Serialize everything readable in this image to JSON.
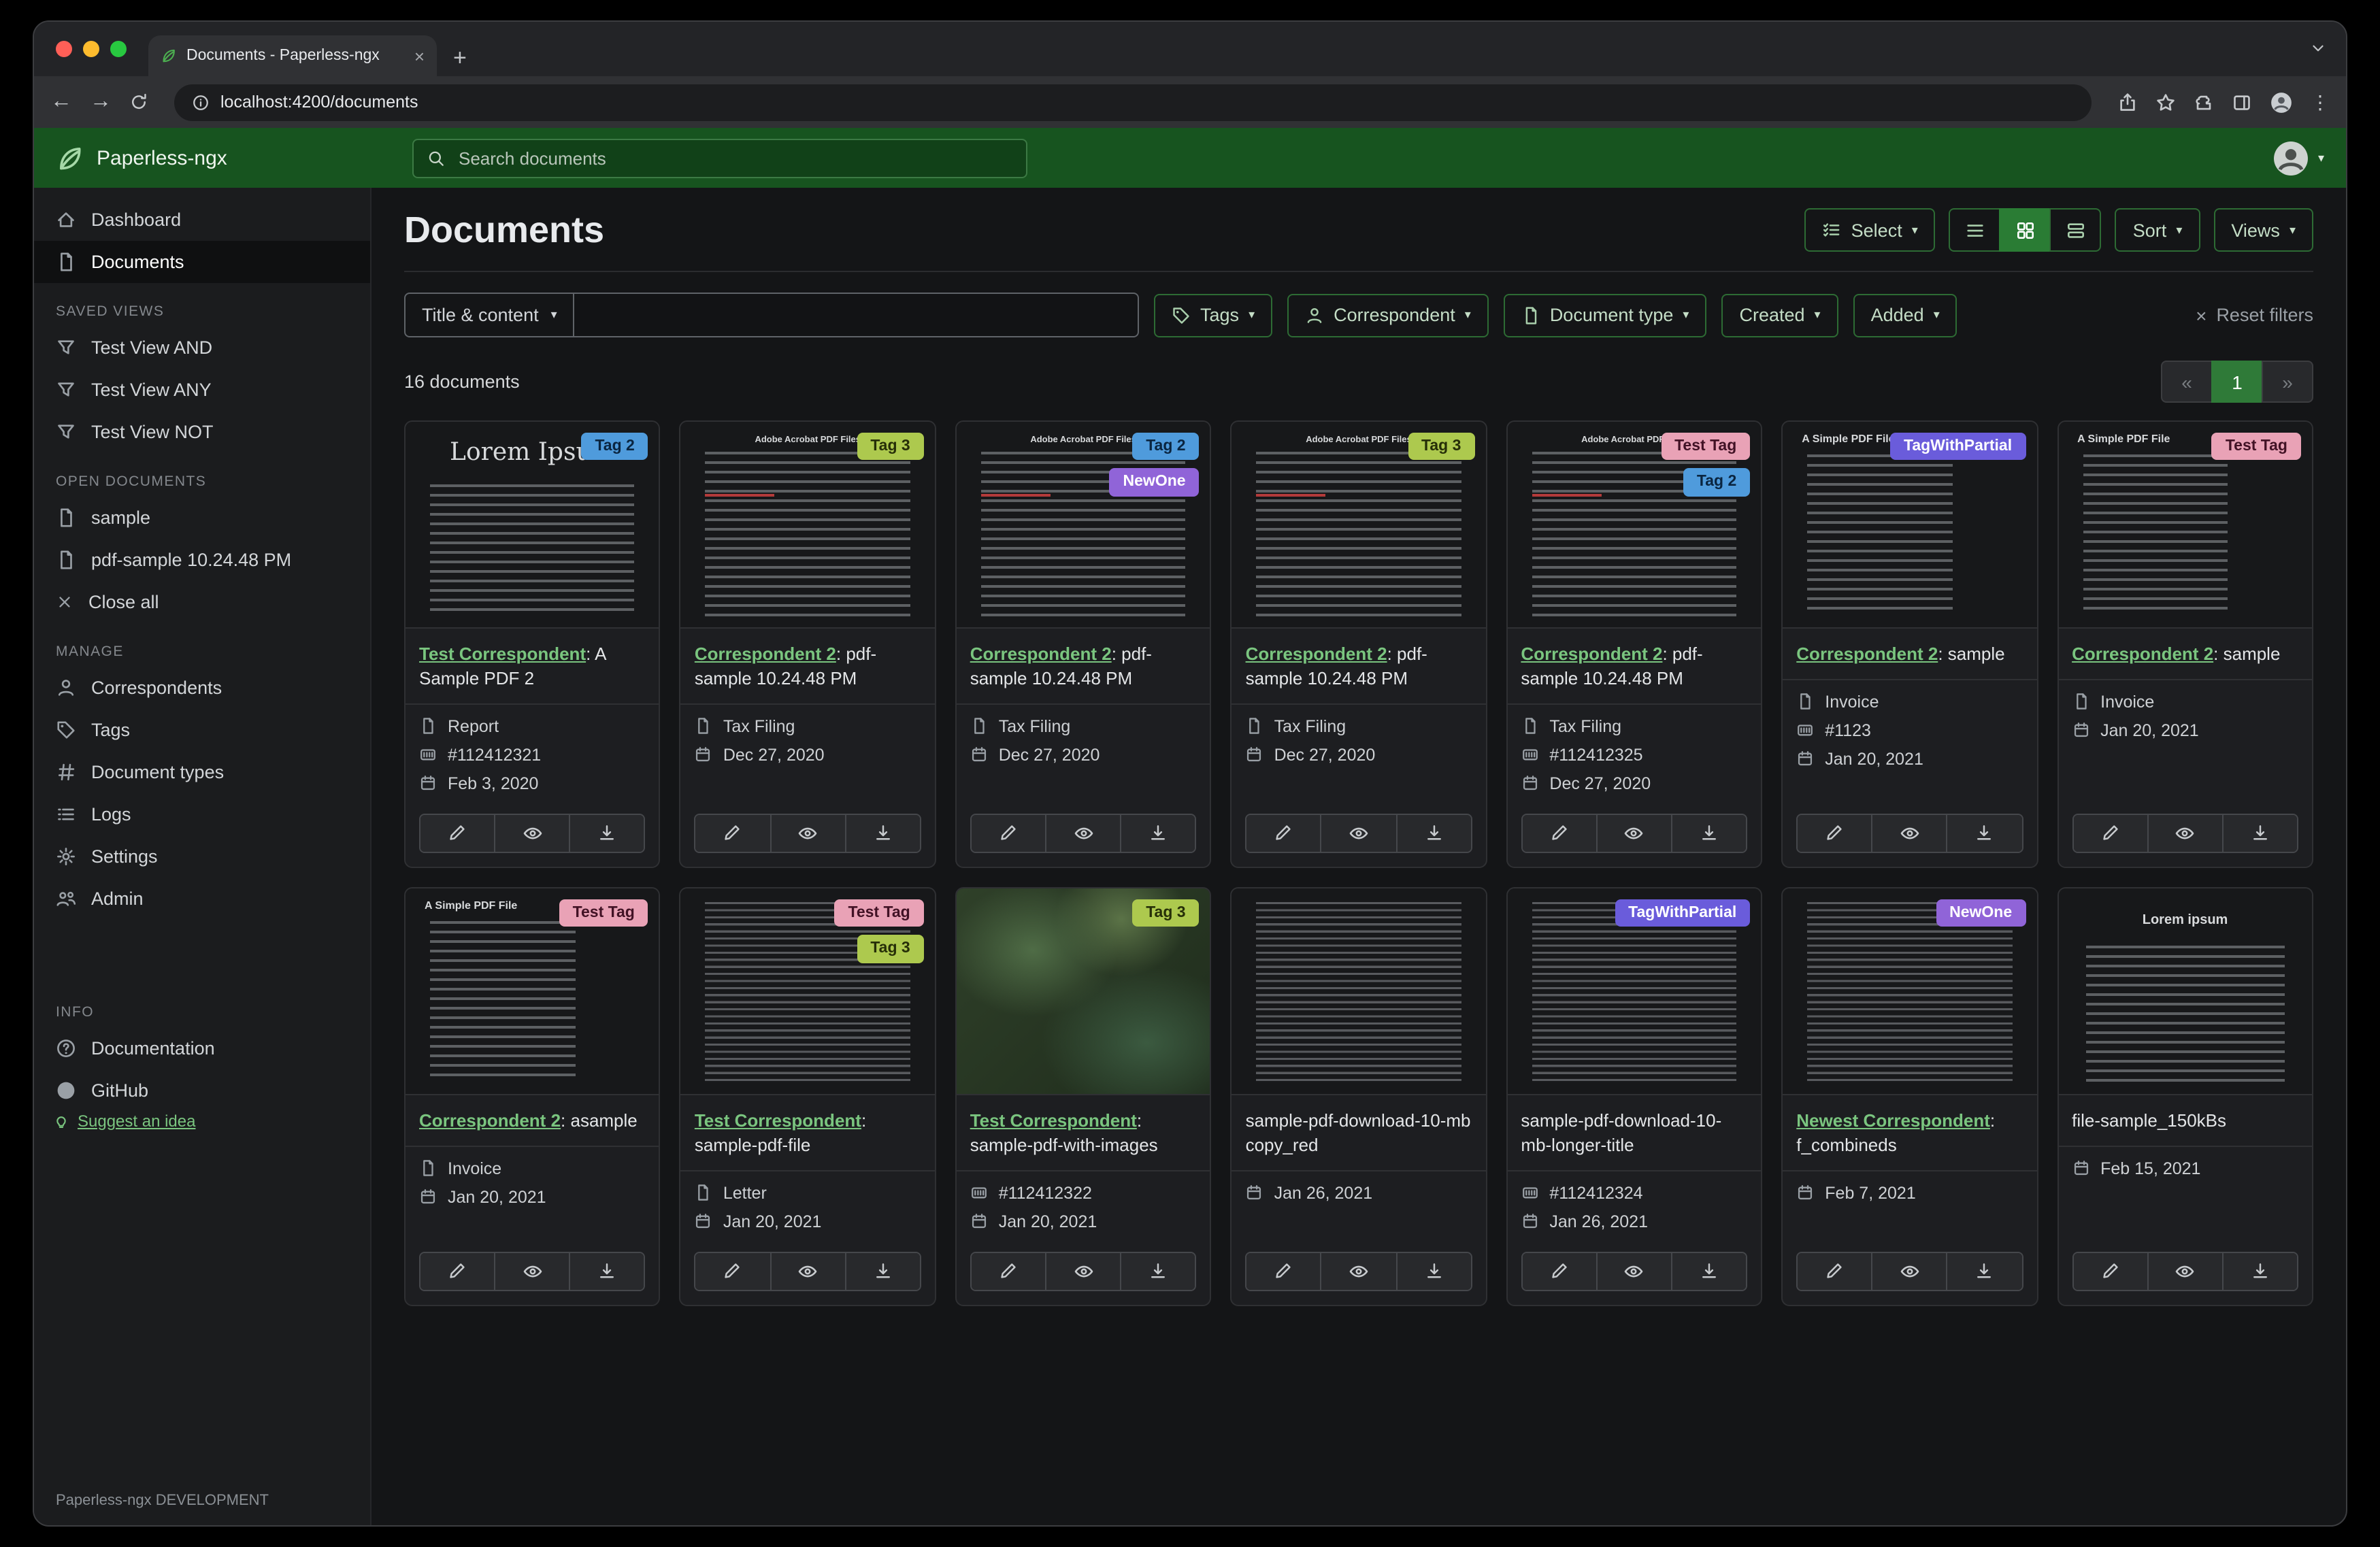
{
  "colors": {
    "accent_green": "#17541f",
    "link_green": "#7ac57f",
    "tag_colors": {
      "Tag 2": {
        "bg": "#4f9bdc",
        "fg": "#0a2540"
      },
      "Tag 3": {
        "bg": "#adc94e",
        "fg": "#262f08"
      },
      "NewOne": {
        "bg": "#9064d8",
        "fg": "#ffffff"
      },
      "Test Tag": {
        "bg": "#e9a2b6",
        "fg": "#421225"
      },
      "TagWithPartial": {
        "bg": "#6a5cdb",
        "fg": "#ffffff"
      }
    }
  },
  "browser": {
    "tab_title": "Documents - Paperless-ngx",
    "new_tab": "+",
    "url": "localhost:4200/documents"
  },
  "header": {
    "app_name": "Paperless-ngx",
    "search_placeholder": "Search documents"
  },
  "sidebar": {
    "nav": [
      {
        "label": "Dashboard"
      },
      {
        "label": "Documents"
      }
    ],
    "saved_views_header": "SAVED VIEWS",
    "saved_views": [
      "Test View AND",
      "Test View ANY",
      "Test View NOT"
    ],
    "open_documents_header": "OPEN DOCUMENTS",
    "open_documents": [
      "sample",
      "pdf-sample 10.24.48 PM"
    ],
    "close_all": "Close all",
    "manage_header": "MANAGE",
    "manage": [
      "Correspondents",
      "Tags",
      "Document types",
      "Logs",
      "Settings",
      "Admin"
    ],
    "info_header": "INFO",
    "documentation": "Documentation",
    "github": "GitHub",
    "suggest": "Suggest an idea",
    "footer": "Paperless-ngx DEVELOPMENT"
  },
  "main": {
    "title": "Documents",
    "select_label": "Select",
    "sort_label": "Sort",
    "views_label": "Views",
    "filter_title_content": "Title & content",
    "filter_buttons": [
      "Tags",
      "Correspondent",
      "Document type",
      "Created",
      "Added"
    ],
    "reset_label": "Reset filters",
    "count_text": "16 documents",
    "pagination": {
      "prev": "«",
      "page": "1",
      "next": "»"
    }
  },
  "cards": [
    {
      "tags": [
        "Tag 2"
      ],
      "thumb": "lorem",
      "thumb_title": "Lorem Ipsum",
      "correspondent": "Test Correspondent",
      "title_rest": ": A Sample PDF 2",
      "doc_type": "Report",
      "asn": "#112412321",
      "date": "Feb 3, 2020"
    },
    {
      "tags": [
        "Tag 3"
      ],
      "thumb": "pdfguide",
      "thumb_title": "Adobe Acrobat PDF Files",
      "correspondent": "Correspondent 2",
      "title_rest": ": pdf-sample 10.24.48 PM",
      "doc_type": "Tax Filing",
      "date": "Dec 27, 2020"
    },
    {
      "tags": [
        "Tag 2",
        "NewOne"
      ],
      "thumb": "pdfguide",
      "thumb_title": "Adobe Acrobat PDF Files",
      "correspondent": "Correspondent 2",
      "title_rest": ": pdf-sample 10.24.48 PM",
      "doc_type": "Tax Filing",
      "date": "Dec 27, 2020"
    },
    {
      "tags": [
        "Tag 3"
      ],
      "thumb": "pdfguide",
      "thumb_title": "Adobe Acrobat PDF Files",
      "correspondent": "Correspondent 2",
      "title_rest": ": pdf-sample 10.24.48 PM",
      "doc_type": "Tax Filing",
      "date": "Dec 27, 2020"
    },
    {
      "tags": [
        "Test Tag",
        "Tag 2"
      ],
      "thumb": "pdfguide",
      "thumb_title": "Adobe Acrobat PDF Files",
      "correspondent": "Correspondent 2",
      "title_rest": ": pdf-sample 10.24.48 PM",
      "doc_type": "Tax Filing",
      "asn": "#112412325",
      "date": "Dec 27, 2020"
    },
    {
      "tags": [
        "TagWithPartial"
      ],
      "thumb": "simple",
      "thumb_title": "A Simple PDF File",
      "correspondent": "Correspondent 2",
      "title_rest": ": sample",
      "doc_type": "Invoice",
      "asn": "#1123",
      "date": "Jan 20, 2021"
    },
    {
      "tags": [
        "Test Tag"
      ],
      "thumb": "simple",
      "thumb_title": "A Simple PDF File",
      "correspondent": "Correspondent 2",
      "title_rest": ": sample",
      "doc_type": "Invoice",
      "date": "Jan 20, 2021"
    },
    {
      "tags": [
        "Test Tag"
      ],
      "thumb": "simple",
      "thumb_title": "A Simple PDF File",
      "correspondent": "Correspondent 2",
      "title_rest": ": asample",
      "doc_type": "Invoice",
      "date": "Jan 20, 2021"
    },
    {
      "tags": [
        "Test Tag",
        "Tag 3"
      ],
      "thumb": "dense",
      "correspondent": "Test Correspondent",
      "title_rest": ": sample-pdf-file",
      "doc_type": "Letter",
      "date": "Jan 20, 2021"
    },
    {
      "tags": [
        "Tag 3"
      ],
      "thumb": "map",
      "correspondent": "Test Correspondent",
      "title_rest": ": sample-pdf-with-images",
      "asn": "#112412322",
      "date": "Jan 20, 2021"
    },
    {
      "tags": [],
      "thumb": "dense",
      "title_rest": "sample-pdf-download-10-mb copy_red",
      "date": "Jan 26, 2021"
    },
    {
      "tags": [
        "TagWithPartial"
      ],
      "thumb": "dense",
      "title_rest": "sample-pdf-download-10-mb-longer-title",
      "asn": "#112412324",
      "date": "Jan 26, 2021"
    },
    {
      "tags": [
        "NewOne"
      ],
      "thumb": "dense",
      "correspondent": "Newest Correspondent",
      "title_rest": ": f_combineds",
      "date": "Feb 7, 2021"
    },
    {
      "tags": [],
      "thumb": "loremcenter",
      "thumb_title": "Lorem ipsum",
      "title_rest": "file-sample_150kBs",
      "date": "Feb 15, 2021"
    }
  ]
}
